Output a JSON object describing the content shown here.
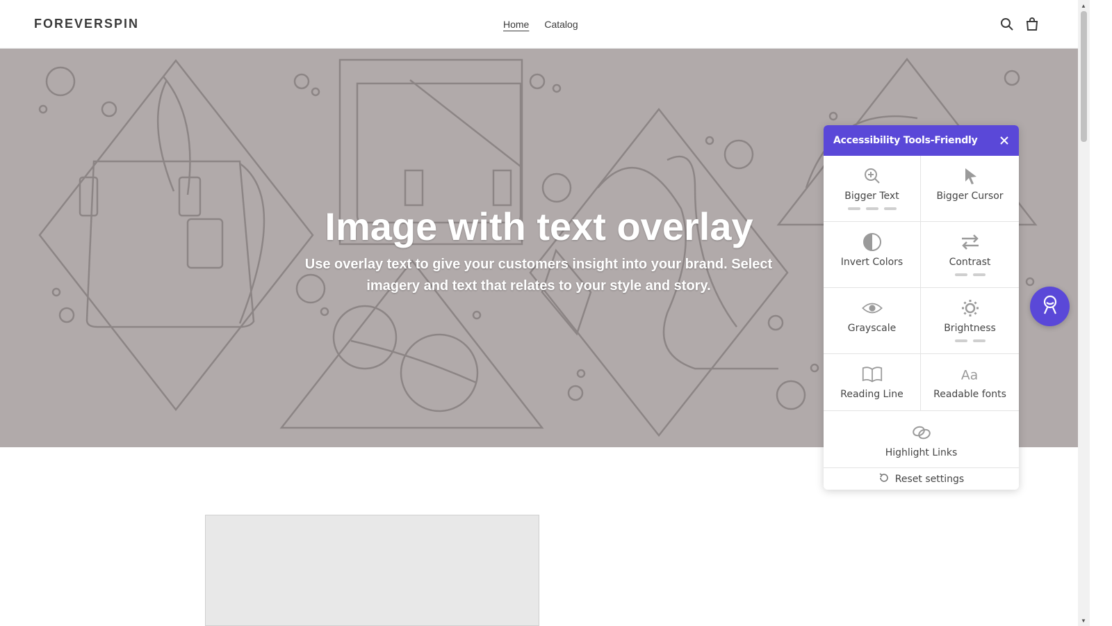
{
  "header": {
    "logo": "FOREVERSPIN",
    "nav": [
      {
        "label": "Home",
        "active": true
      },
      {
        "label": "Catalog",
        "active": false
      }
    ],
    "icons": [
      "search-icon",
      "cart-icon"
    ]
  },
  "hero": {
    "title": "Image with text overlay",
    "subtitle": "Use overlay text to give your customers insight into your brand. Select imagery and text that relates to your style and story.",
    "background_color": "#b1aaaa"
  },
  "accessibility_panel": {
    "title": "Accessibility Tools-Friendly",
    "accent_color": "#5a48d8",
    "tools": [
      {
        "label": "Bigger Text",
        "icon": "zoom-in-icon"
      },
      {
        "label": "Bigger Cursor",
        "icon": "cursor-icon"
      },
      {
        "label": "Invert Colors",
        "icon": "half-circle-icon"
      },
      {
        "label": "Contrast",
        "icon": "swap-arrows-icon"
      },
      {
        "label": "Grayscale",
        "icon": "eye-icon"
      },
      {
        "label": "Brightness",
        "icon": "sun-icon"
      },
      {
        "label": "Reading Line",
        "icon": "book-icon"
      },
      {
        "label": "Readable fonts",
        "icon": "font-aa-icon"
      },
      {
        "label": "Highlight Links",
        "icon": "link-icon"
      }
    ],
    "reset_label": "Reset settings"
  },
  "fab_icon": "accessibility-person-icon"
}
